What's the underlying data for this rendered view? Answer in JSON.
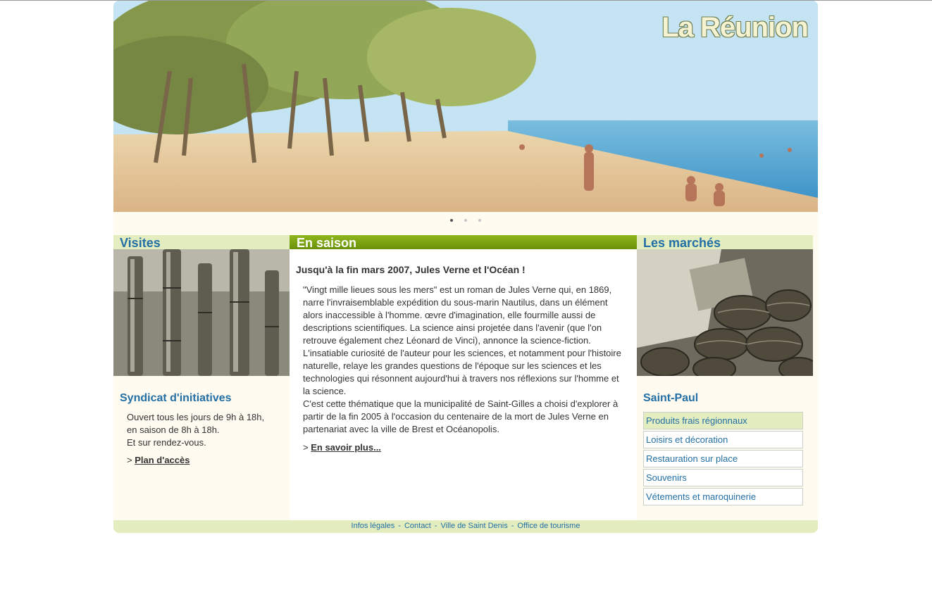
{
  "banner": {
    "logo_text": "La Réunion",
    "slides": [
      {
        "active": true
      },
      {
        "active": false
      },
      {
        "active": false
      }
    ]
  },
  "left": {
    "heading": "Visites",
    "subheading": "Syndicat d'initiatives",
    "info_lines": [
      "Ouvert tous les jours de 9h à 18h,",
      "en saison de 8h à 18h.",
      "Et sur rendez-vous."
    ],
    "link_prefix": "> ",
    "link_label": "Plan d'accès"
  },
  "middle": {
    "heading": "En saison",
    "article_title": "Jusqu'à la fin mars 2007, Jules Verne et l'Océan !",
    "paragraph_1": "\"Vingt mille lieues sous les mers\" est un roman de Jules Verne qui, en 1869, narre l'invraisemblable expédition du sous-marin Nautilus, dans un élément alors inaccessible à l'homme. œvre d'imagination, elle fourmille aussi de descriptions scientifiques. La science ainsi projetée dans l'avenir (que l'on retrouve également chez Léonard de Vinci), annonce la science-fiction. L'insatiable curiosité de l'auteur pour les sciences, et notamment pour l'histoire naturelle, relaye les grandes questions de l'époque sur les sciences et les technologies qui résonnent aujourd'hui à travers nos réflexions sur l'homme et la science.",
    "paragraph_2": "C'est cette thématique que la municipalité de Saint-Gilles a choisi d'explorer à partir de la fin 2005 à l'occasion du centenaire de la mort de Jules Verne en partenariat avec la ville de Brest et Océanopolis.",
    "link_prefix": "> ",
    "link_label": "En savoir plus..."
  },
  "right": {
    "heading": "Les marchés",
    "subheading": "Saint-Paul",
    "items": [
      {
        "label": "Produits frais régionnaux",
        "active": true
      },
      {
        "label": "Loisirs et décoration",
        "active": false
      },
      {
        "label": "Restauration sur place",
        "active": false
      },
      {
        "label": "Souvenirs",
        "active": false
      },
      {
        "label": "Vétements et maroquinerie",
        "active": false
      }
    ]
  },
  "footer": {
    "links": [
      "Infos légales",
      "Contact",
      "Ville de Saint Denis",
      "Office de tourisme"
    ],
    "separator": "-"
  }
}
